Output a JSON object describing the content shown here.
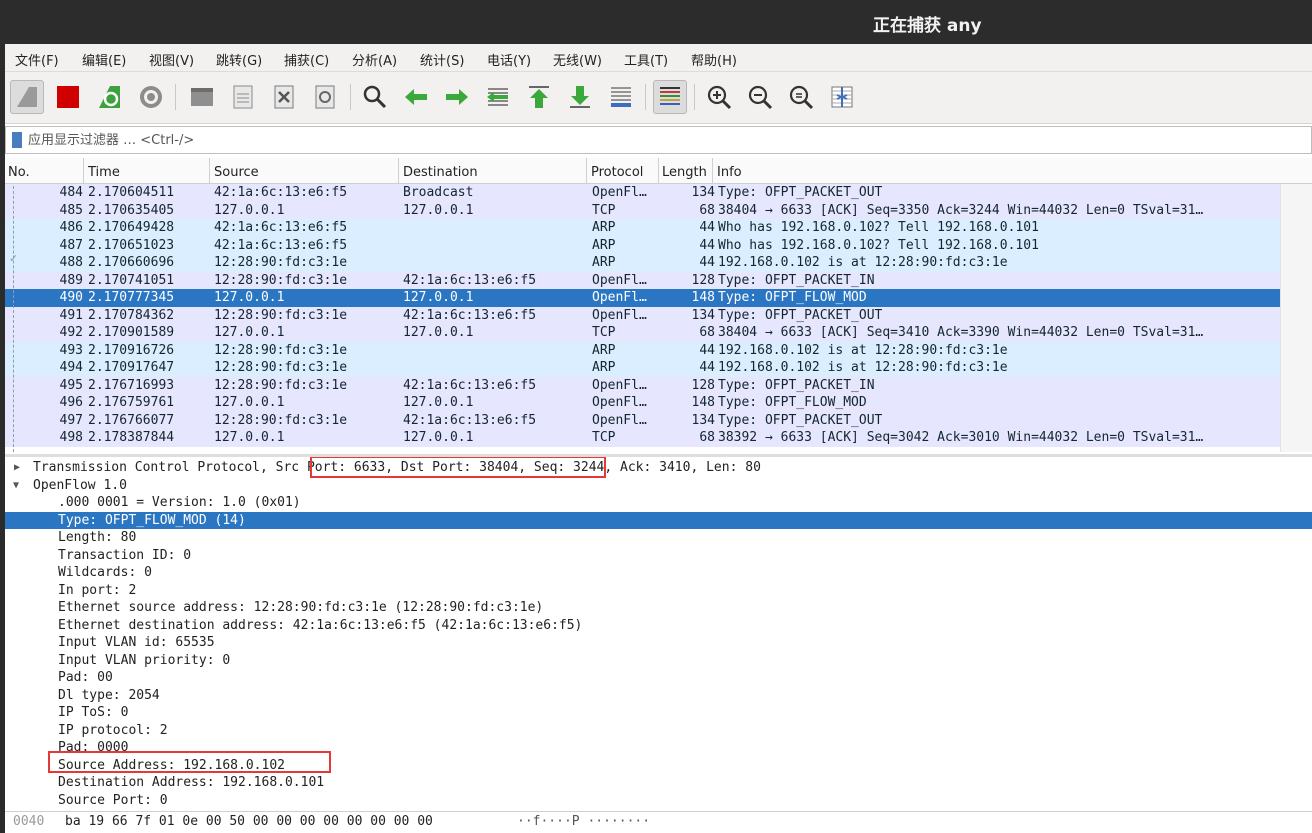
{
  "window": {
    "title": "正在捕获 any"
  },
  "menu": [
    "文件(F)",
    "编辑(E)",
    "视图(V)",
    "跳转(G)",
    "捕获(C)",
    "分析(A)",
    "统计(S)",
    "电话(Y)",
    "无线(W)",
    "工具(T)",
    "帮助(H)"
  ],
  "toolbar": {
    "icons": [
      "shark-fin-start-icon",
      "stop-capture-icon",
      "restart-capture-icon",
      "capture-options-gear-icon",
      "open-file-icon",
      "save-file-icon",
      "close-file-icon",
      "reload-file-icon",
      "find-packet-icon",
      "go-back-icon",
      "go-forward-icon",
      "go-to-packet-icon",
      "go-first-packet-icon",
      "go-last-packet-icon",
      "auto-scroll-icon",
      "colorize-icon",
      "zoom-in-icon",
      "zoom-out-icon",
      "normal-size-icon",
      "resize-columns-icon"
    ]
  },
  "filter": {
    "placeholder": "应用显示过滤器 … <Ctrl-/>"
  },
  "packet_list": {
    "columns": [
      "No.",
      "Time",
      "Source",
      "Destination",
      "Protocol",
      "Length",
      "Info"
    ],
    "selected_no": "490",
    "rows": [
      {
        "no": "484",
        "time": "2.170604511",
        "src": "42:1a:6c:13:e6:f5",
        "dst": "Broadcast",
        "proto": "OpenFl…",
        "len": "134",
        "info": "Type: OFPT_PACKET_OUT",
        "color": "of"
      },
      {
        "no": "485",
        "time": "2.170635405",
        "src": "127.0.0.1",
        "dst": "127.0.0.1",
        "proto": "TCP",
        "len": "68",
        "info": "38404 → 6633 [ACK] Seq=3350 Ack=3244 Win=44032 Len=0 TSval=31…",
        "color": "tcp"
      },
      {
        "no": "486",
        "time": "2.170649428",
        "src": "42:1a:6c:13:e6:f5",
        "dst": "",
        "proto": "ARP",
        "len": "44",
        "info": "Who has 192.168.0.102? Tell 192.168.0.101",
        "color": "arp"
      },
      {
        "no": "487",
        "time": "2.170651023",
        "src": "42:1a:6c:13:e6:f5",
        "dst": "",
        "proto": "ARP",
        "len": "44",
        "info": "Who has 192.168.0.102? Tell 192.168.0.101",
        "color": "arp"
      },
      {
        "no": "488",
        "time": "2.170660696",
        "src": "12:28:90:fd:c3:1e",
        "dst": "",
        "proto": "ARP",
        "len": "44",
        "info": "192.168.0.102 is at 12:28:90:fd:c3:1e",
        "color": "arp"
      },
      {
        "no": "489",
        "time": "2.170741051",
        "src": "12:28:90:fd:c3:1e",
        "dst": "42:1a:6c:13:e6:f5",
        "proto": "OpenFl…",
        "len": "128",
        "info": "Type: OFPT_PACKET_IN",
        "color": "of"
      },
      {
        "no": "490",
        "time": "2.170777345",
        "src": "127.0.0.1",
        "dst": "127.0.0.1",
        "proto": "OpenFl…",
        "len": "148",
        "info": "Type: OFPT_FLOW_MOD",
        "color": "of"
      },
      {
        "no": "491",
        "time": "2.170784362",
        "src": "12:28:90:fd:c3:1e",
        "dst": "42:1a:6c:13:e6:f5",
        "proto": "OpenFl…",
        "len": "134",
        "info": "Type: OFPT_PACKET_OUT",
        "color": "of"
      },
      {
        "no": "492",
        "time": "2.170901589",
        "src": "127.0.0.1",
        "dst": "127.0.0.1",
        "proto": "TCP",
        "len": "68",
        "info": "38404 → 6633 [ACK] Seq=3410 Ack=3390 Win=44032 Len=0 TSval=31…",
        "color": "tcp"
      },
      {
        "no": "493",
        "time": "2.170916726",
        "src": "12:28:90:fd:c3:1e",
        "dst": "",
        "proto": "ARP",
        "len": "44",
        "info": "192.168.0.102 is at 12:28:90:fd:c3:1e",
        "color": "arp"
      },
      {
        "no": "494",
        "time": "2.170917647",
        "src": "12:28:90:fd:c3:1e",
        "dst": "",
        "proto": "ARP",
        "len": "44",
        "info": "192.168.0.102 is at 12:28:90:fd:c3:1e",
        "color": "arp"
      },
      {
        "no": "495",
        "time": "2.176716993",
        "src": "12:28:90:fd:c3:1e",
        "dst": "42:1a:6c:13:e6:f5",
        "proto": "OpenFl…",
        "len": "128",
        "info": "Type: OFPT_PACKET_IN",
        "color": "of"
      },
      {
        "no": "496",
        "time": "2.176759761",
        "src": "127.0.0.1",
        "dst": "127.0.0.1",
        "proto": "OpenFl…",
        "len": "148",
        "info": "Type: OFPT_FLOW_MOD",
        "color": "of"
      },
      {
        "no": "497",
        "time": "2.176766077",
        "src": "12:28:90:fd:c3:1e",
        "dst": "42:1a:6c:13:e6:f5",
        "proto": "OpenFl…",
        "len": "134",
        "info": "Type: OFPT_PACKET_OUT",
        "color": "of"
      },
      {
        "no": "498",
        "time": "2.178387844",
        "src": "127.0.0.1",
        "dst": "127.0.0.1",
        "proto": "TCP",
        "len": "68",
        "info": "38392 → 6633 [ACK] Seq=3042 Ack=3010 Win=44032 Len=0 TSval=31…",
        "color": "tcp"
      }
    ]
  },
  "details": {
    "tcp_line": {
      "prefix": "Transmission Control Protocol, ",
      "highlight": "Src Port: 6633, Dst Port: 38404,",
      "suffix": " Seq: 3244, Ack: 3410, Len: 80"
    },
    "openflow_header": "OpenFlow 1.0",
    "fields": [
      ".000 0001 = Version: 1.0 (0x01)",
      "Type: OFPT_FLOW_MOD (14)",
      "Length: 80",
      "Transaction ID: 0",
      "Wildcards: 0",
      "In port: 2",
      "Ethernet source address: 12:28:90:fd:c3:1e (12:28:90:fd:c3:1e)",
      "Ethernet destination address: 42:1a:6c:13:e6:f5 (42:1a:6c:13:e6:f5)",
      "Input VLAN id: 65535",
      "Input VLAN priority: 0",
      "Pad: 00",
      "Dl type: 2054",
      "IP ToS: 0",
      "IP protocol: 2",
      "Pad: 0000",
      "Source Address: 192.168.0.102",
      "Destination Address: 192.168.0.101",
      "Source Port: 0"
    ],
    "selected_field_index": 1,
    "boxed_field_index": 15
  },
  "hex": {
    "offset": "0040",
    "bytes": "ba 19 66 7f 01 0e 00 50  00 00 00 00 00 00 00 00",
    "ascii": "··f····P ········"
  },
  "colors": {
    "selected": "#2b76c2",
    "tcp_row": "#e7e6ff",
    "arp_row": "#daeeff",
    "openflow_row": "#e7e6ff",
    "highlight_box": "#e53935"
  }
}
